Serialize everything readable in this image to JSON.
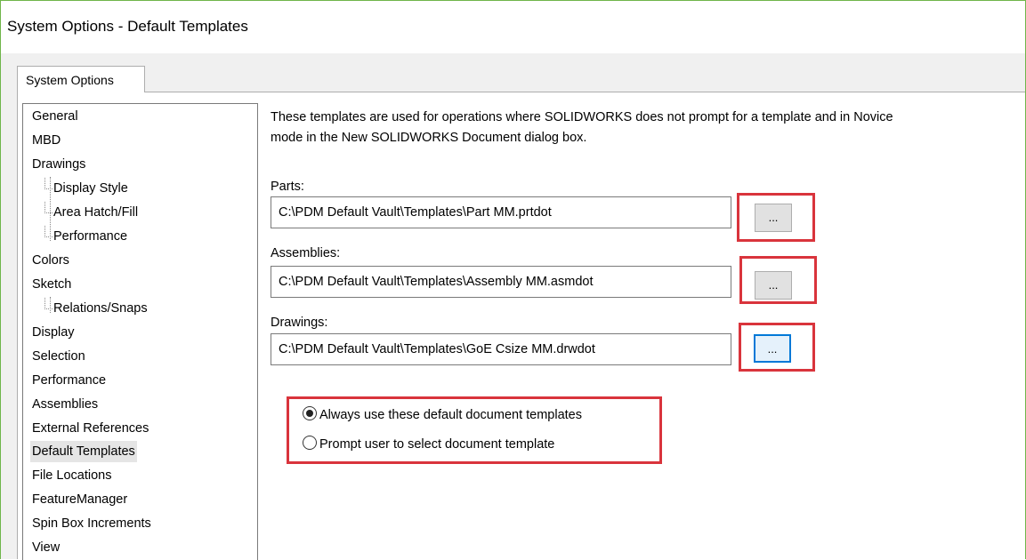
{
  "window": {
    "title": "System Options - Default Templates"
  },
  "tabs": [
    {
      "label": "System Options",
      "active": true
    }
  ],
  "sidebar": {
    "items": [
      {
        "label": "General",
        "level": 0
      },
      {
        "label": "MBD",
        "level": 0
      },
      {
        "label": "Drawings",
        "level": 0
      },
      {
        "label": "Display Style",
        "level": 1
      },
      {
        "label": "Area Hatch/Fill",
        "level": 1
      },
      {
        "label": "Performance",
        "level": 1
      },
      {
        "label": "Colors",
        "level": 0
      },
      {
        "label": "Sketch",
        "level": 0
      },
      {
        "label": "Relations/Snaps",
        "level": 1
      },
      {
        "label": "Display",
        "level": 0
      },
      {
        "label": "Selection",
        "level": 0
      },
      {
        "label": "Performance",
        "level": 0
      },
      {
        "label": "Assemblies",
        "level": 0
      },
      {
        "label": "External References",
        "level": 0
      },
      {
        "label": "Default Templates",
        "level": 0,
        "selected": true
      },
      {
        "label": "File Locations",
        "level": 0
      },
      {
        "label": "FeatureManager",
        "level": 0
      },
      {
        "label": "Spin Box Increments",
        "level": 0
      },
      {
        "label": "View",
        "level": 0
      }
    ]
  },
  "main": {
    "description": "These templates are used for operations where SOLIDWORKS does not prompt for a template and in Novice mode in the New SOLIDWORKS Document dialog box.",
    "parts": {
      "label": "Parts:",
      "value": "C:\\PDM Default Vault\\Templates\\Part MM.prtdot",
      "browse_label": "..."
    },
    "assemblies": {
      "label": "Assemblies:",
      "value": "C:\\PDM Default Vault\\Templates\\Assembly MM.asmdot",
      "browse_label": "..."
    },
    "drawings": {
      "label": "Drawings:",
      "value": "C:\\PDM Default Vault\\Templates\\GoE Csize MM.drwdot",
      "browse_label": "..."
    },
    "options": {
      "always_label": "Always use these default document templates",
      "prompt_label": "Prompt user to select document template",
      "selected": "always"
    }
  },
  "colors": {
    "highlight": "#d9343c",
    "focus": "#0078d7",
    "window_border": "#6fb54a"
  }
}
